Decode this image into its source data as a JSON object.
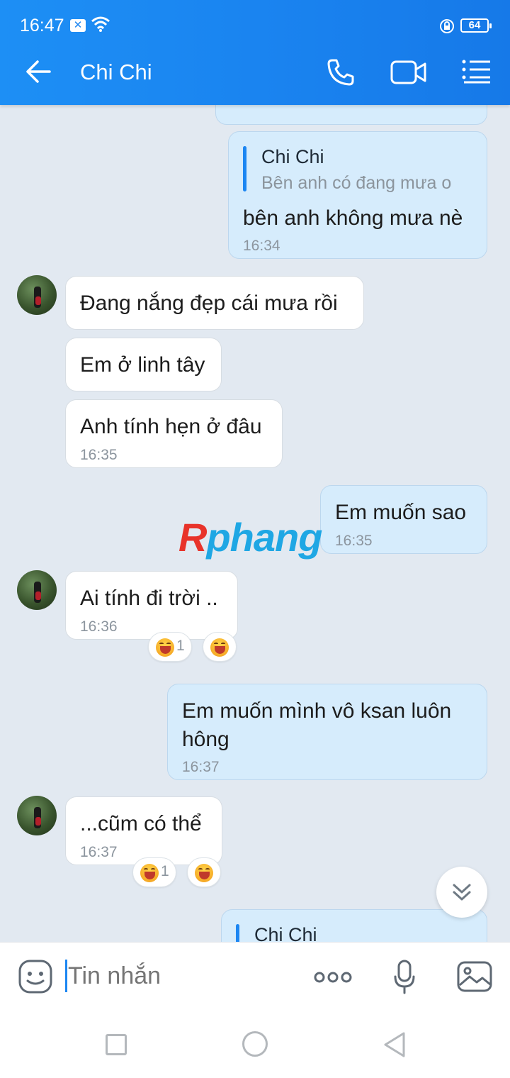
{
  "status_bar": {
    "time": "16:47",
    "battery": "64"
  },
  "header": {
    "contact_name": "Chi Chi"
  },
  "messages": [
    {
      "direction": "out",
      "reply_to": {
        "name": "Chi Chi",
        "text": "Bên anh có đang mưa o"
      },
      "text": "bên anh không mưa nè",
      "time": "16:34"
    },
    {
      "direction": "in",
      "text": "Đang nắng đẹp cái mưa rồi"
    },
    {
      "direction": "in",
      "text": "Em ở linh tây"
    },
    {
      "direction": "in",
      "text": "Anh tính hẹn ở đâu",
      "time": "16:35"
    },
    {
      "direction": "out",
      "text": "Em muốn sao",
      "time": "16:35"
    },
    {
      "direction": "in",
      "text": "Ai tính đi trời ..",
      "time": "16:36",
      "reaction_count": "1"
    },
    {
      "direction": "out",
      "text_line1": "Em muốn mình vô ksan luôn",
      "text_line2": "hông",
      "time": "16:37"
    },
    {
      "direction": "in",
      "text": "...cũm có thể",
      "time": "16:37",
      "reaction_count": "1"
    },
    {
      "direction": "out",
      "reply_to": {
        "name": "Chi Chi"
      }
    }
  ],
  "watermark": {
    "first_letter": "R",
    "rest": "phang"
  },
  "composer": {
    "placeholder": "Tin nhắn"
  },
  "colors": {
    "accent": "#1a84f0",
    "outgoing_bubble": "#d6ecfc",
    "background": "#e2e9f1"
  }
}
